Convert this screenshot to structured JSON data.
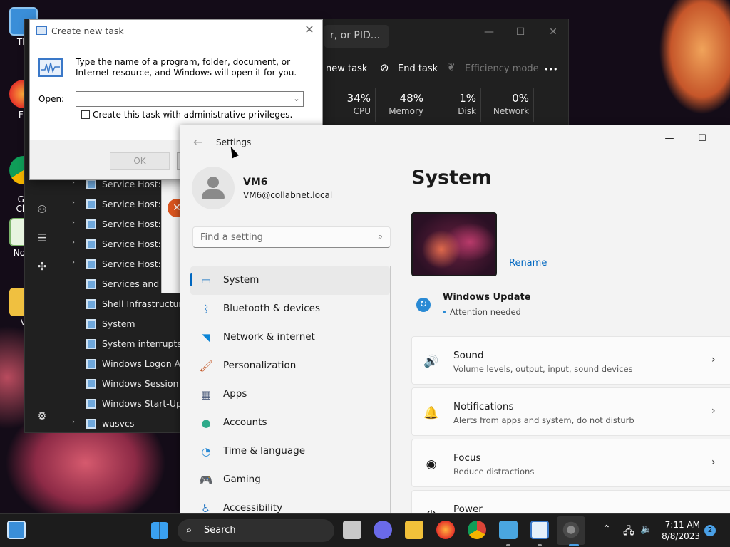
{
  "desktop": {
    "icons": [
      {
        "label": "Thi"
      },
      {
        "label": "Fir"
      },
      {
        "label": "Go\nChr"
      },
      {
        "label": "Note"
      },
      {
        "label": "V"
      }
    ]
  },
  "taskmgr": {
    "search_fragment": "r, or PID...",
    "toolbar": {
      "new_task": "new task",
      "end_task": "End task",
      "efficiency_mode": "Efficiency mode",
      "more": "•••"
    },
    "columns": [
      {
        "pct": "34%",
        "name": "CPU"
      },
      {
        "pct": "48%",
        "name": "Memory"
      },
      {
        "pct": "1%",
        "name": "Disk"
      },
      {
        "pct": "0%",
        "name": "Network"
      }
    ],
    "rows": [
      {
        "name": "Service Host: Wi",
        "expandable": true
      },
      {
        "name": "Service Host: Wi",
        "expandable": true
      },
      {
        "name": "Service Host: Wi",
        "expandable": true
      },
      {
        "name": "Service Host: Wi",
        "expandable": true
      },
      {
        "name": "Service Host: Wi",
        "expandable": true
      },
      {
        "name": "Services and Co",
        "expandable": false
      },
      {
        "name": "Shell Infrastructure H",
        "expandable": false
      },
      {
        "name": "System",
        "expandable": false
      },
      {
        "name": "System interrupts",
        "expandable": false
      },
      {
        "name": "Windows Logon App",
        "expandable": false
      },
      {
        "name": "Windows Session Ma",
        "expandable": false
      },
      {
        "name": "Windows Start-Up Ap",
        "expandable": false
      },
      {
        "name": "wusvcs",
        "expandable": true
      }
    ]
  },
  "dialog": {
    "title": "Create new task",
    "description": "Type the name of a program, folder, document, or Internet resource, and Windows will open it for you.",
    "open_label": "Open:",
    "input_value": "",
    "admin_checkbox_label": "Create this task with administrative privileges.",
    "ok_label": "OK"
  },
  "settings": {
    "app_title": "Settings",
    "user_name": "VM6",
    "user_email": "VM6@collabnet.local",
    "search_placeholder": "Find a setting",
    "page_title": "System",
    "rename_label": "Rename",
    "windows_update": {
      "title": "Windows Update",
      "status": "Attention needed"
    },
    "nav": [
      {
        "label": "System",
        "icon": "display-icon",
        "selected": true
      },
      {
        "label": "Bluetooth & devices",
        "icon": "bluetooth-icon",
        "selected": false
      },
      {
        "label": "Network & internet",
        "icon": "wifi-icon",
        "selected": false
      },
      {
        "label": "Personalization",
        "icon": "brush-icon",
        "selected": false
      },
      {
        "label": "Apps",
        "icon": "apps-icon",
        "selected": false
      },
      {
        "label": "Accounts",
        "icon": "person-icon",
        "selected": false
      },
      {
        "label": "Time & language",
        "icon": "globe-clock-icon",
        "selected": false
      },
      {
        "label": "Gaming",
        "icon": "gamepad-icon",
        "selected": false
      },
      {
        "label": "Accessibility",
        "icon": "accessibility-icon",
        "selected": false
      }
    ],
    "cards": [
      {
        "title": "Sound",
        "subtitle": "Volume levels, output, input, sound devices",
        "icon": "speaker-icon"
      },
      {
        "title": "Notifications",
        "subtitle": "Alerts from apps and system, do not disturb",
        "icon": "bell-icon"
      },
      {
        "title": "Focus",
        "subtitle": "Reduce distractions",
        "icon": "focus-icon"
      },
      {
        "title": "Power",
        "subtitle": "",
        "icon": "power-icon"
      }
    ]
  },
  "taskbar": {
    "search_label": "Search",
    "time": "7:11 AM",
    "date": "8/8/2023",
    "notification_count": "2"
  }
}
